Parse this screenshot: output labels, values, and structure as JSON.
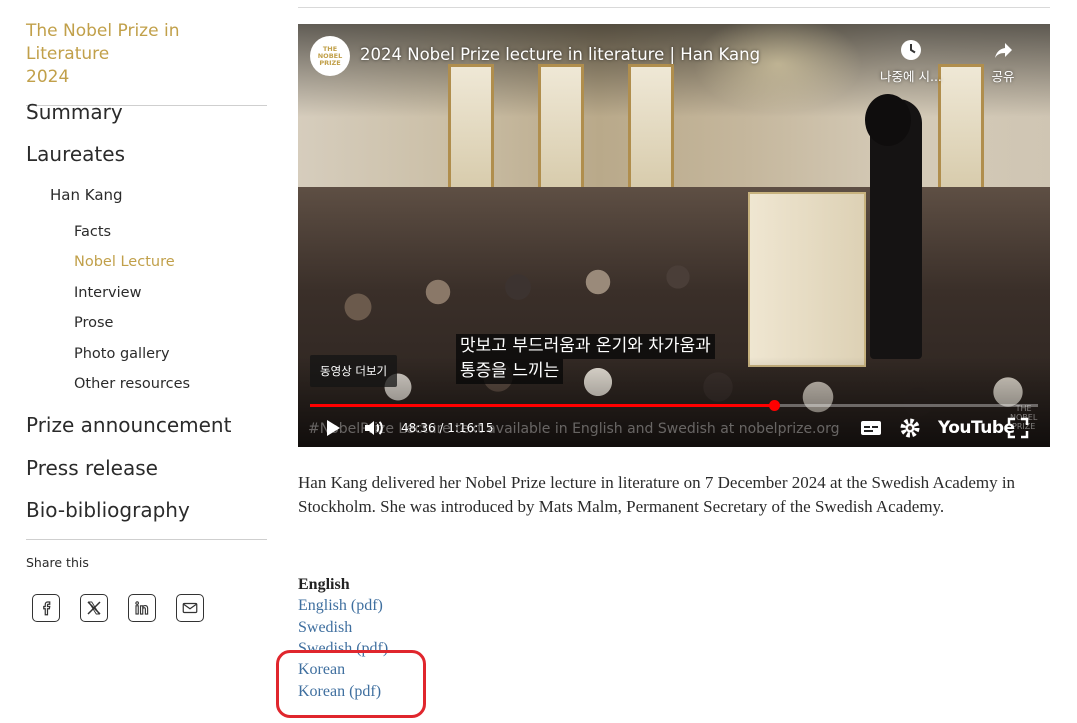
{
  "sidebar": {
    "prize_title_line1": "The Nobel Prize in Literature",
    "prize_title_line2": "2024",
    "summary": "Summary",
    "laureates": "Laureates",
    "laureate_name": "Han Kang",
    "sub_items": [
      "Facts",
      "Nobel Lecture",
      "Interview",
      "Prose",
      "Photo gallery",
      "Other resources"
    ],
    "active_item": "Nobel Lecture",
    "prize_announcement": "Prize announcement",
    "press_release": "Press release",
    "bio_bibliography": "Bio-bibliography",
    "share_label": "Share this",
    "share_icons": [
      "facebook-icon",
      "x-icon",
      "linkedin-icon",
      "mail-icon"
    ]
  },
  "video": {
    "channel_logo_line1": "THE",
    "channel_logo_line2": "NOBEL",
    "channel_logo_line3": "PRIZE",
    "title": "2024 Nobel Prize lecture in literature | Han Kang",
    "watch_later": "나중에 시...",
    "share": "공유",
    "more_videos": "동영상 더보기",
    "subtitle_line1": "맛보고 부드러움과 온기와 차가움과",
    "subtitle_line2": "통증을 느끼는",
    "time": "48:36 / 1:16:15",
    "progress_fraction": 0.6374,
    "watermark": "#NobelPrize     Lecture text available in English and Swedish at nobelprize.org",
    "youtube_label": "YouTube",
    "corner_line1": "THE",
    "corner_line2": "NOBEL",
    "corner_line3": "PRIZE"
  },
  "intro": "Han Kang delivered her Nobel Prize lecture in literature on 7 December 2024 at the Swedish Academy in Stockholm. She was introduced by Mats Malm, Permanent Secretary of the Swedish Academy.",
  "downloads": {
    "heading": "English",
    "links": [
      "English (pdf)",
      "Swedish",
      "Swedish (pdf)",
      "Korean",
      "Korean (pdf)"
    ]
  },
  "colors": {
    "accent_gold": "#c1a04a",
    "link_blue": "#3f6f9f",
    "progress_red": "#ff0000",
    "highlight_red": "#e0262d"
  }
}
